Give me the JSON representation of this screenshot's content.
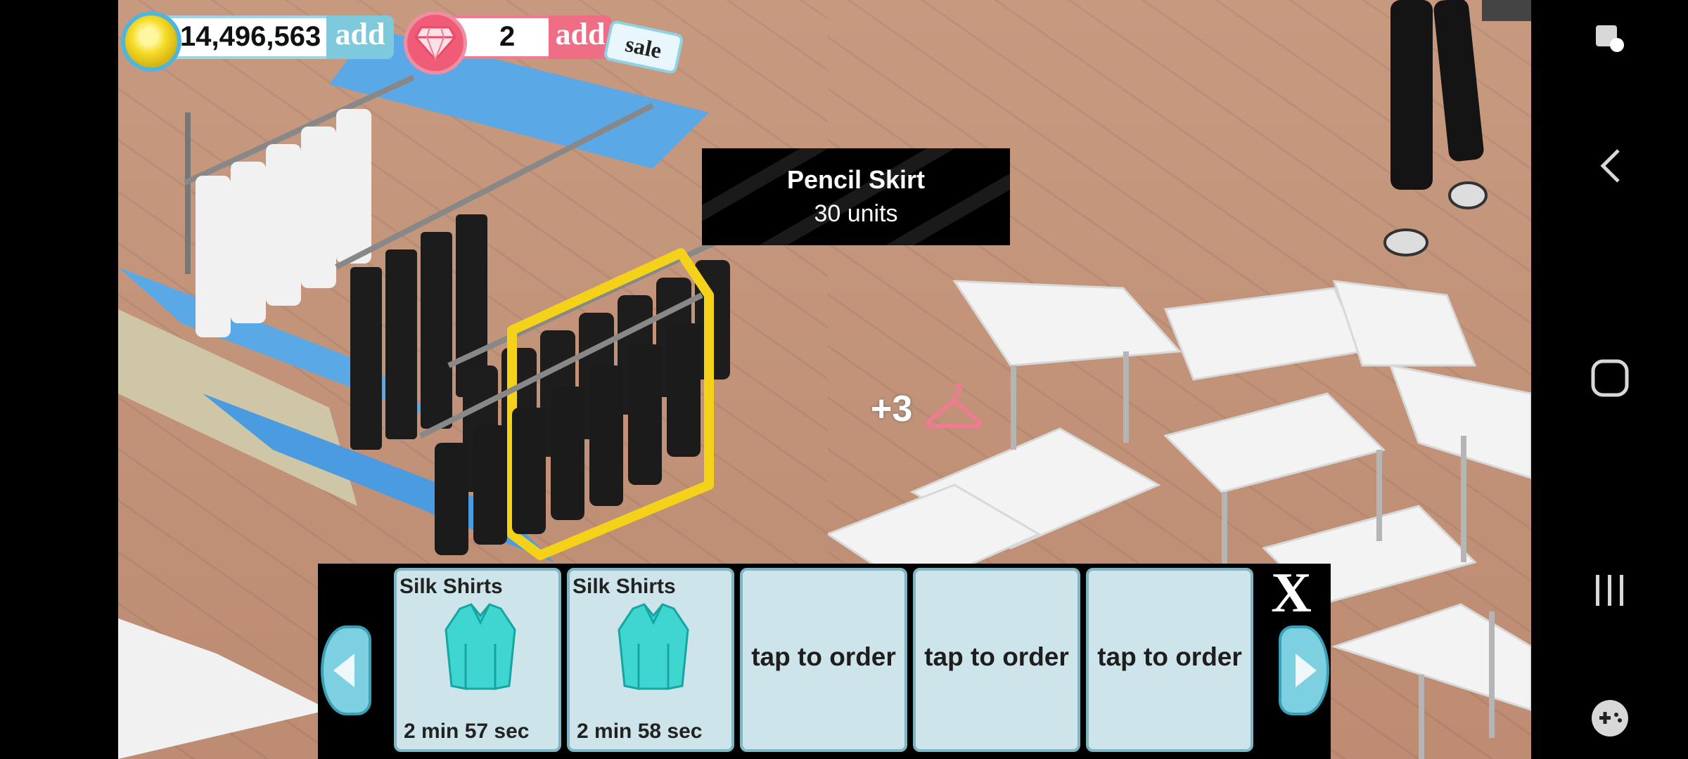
{
  "currency": {
    "coins": "14,496,563",
    "coins_add": "add",
    "gems": "2",
    "gems_add": "add",
    "sale": "sale"
  },
  "tooltip": {
    "title": "Pencil Skirt",
    "subtitle": "30 units"
  },
  "rack_badge": "+3",
  "order_panel": {
    "slots": [
      {
        "name": "Silk Shirts",
        "time": "2 min 57 sec"
      },
      {
        "name": "Silk Shirts",
        "time": "2 min 58 sec"
      },
      {
        "label": "tap to order"
      },
      {
        "label": "tap to order"
      },
      {
        "label": "tap to order"
      }
    ],
    "close": "X"
  },
  "colors": {
    "coin_border": "#4fb5dc",
    "gem": "#f05c78",
    "shirt": "#3fd6d0",
    "slot_bg": "#cde4ea",
    "rack_highlight": "#f5d21a"
  },
  "icons": [
    "coin-icon",
    "diamond-icon",
    "hanger-icon",
    "shirt-icon",
    "screenshot-icon",
    "back-icon",
    "home-icon",
    "recents-icon",
    "game-launcher-icon"
  ]
}
